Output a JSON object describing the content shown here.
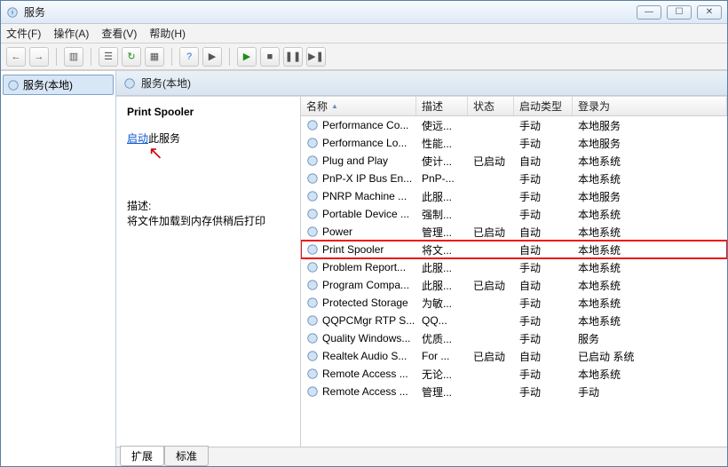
{
  "window": {
    "title": "服务"
  },
  "menu": {
    "file": "文件(F)",
    "action": "操作(A)",
    "view": "查看(V)",
    "help": "帮助(H)"
  },
  "toolbar_icons": {
    "back": "←",
    "forward": "→",
    "up": "↑",
    "show_hide": "▥",
    "props": "☰",
    "refresh": "↻",
    "export": "▦",
    "help": "?",
    "run": "▶",
    "play": "▶",
    "stop": "■",
    "pause": "❚❚",
    "restart": "▶❚"
  },
  "left": {
    "root": "服务(本地)"
  },
  "right_header": {
    "label": "服务(本地)"
  },
  "detail": {
    "title": "Print Spooler",
    "start_link": "启动",
    "start_suffix": "此服务",
    "desc_label": "描述:",
    "desc_text": "将文件加载到内存供稍后打印"
  },
  "columns": {
    "name": "名称",
    "desc": "描述",
    "status": "状态",
    "startup": "启动类型",
    "logon": "登录为"
  },
  "tabs": {
    "extended": "扩展",
    "standard": "标准"
  },
  "rows": [
    {
      "name": "Performance Co...",
      "desc": "使远...",
      "status": "",
      "startup": "手动",
      "logon": "本地服务"
    },
    {
      "name": "Performance Lo...",
      "desc": "性能...",
      "status": "",
      "startup": "手动",
      "logon": "本地服务"
    },
    {
      "name": "Plug and Play",
      "desc": "使计...",
      "status": "已启动",
      "startup": "自动",
      "logon": "本地系统"
    },
    {
      "name": "PnP-X IP Bus En...",
      "desc": "PnP-...",
      "status": "",
      "startup": "手动",
      "logon": "本地系统"
    },
    {
      "name": "PNRP Machine ...",
      "desc": "此服...",
      "status": "",
      "startup": "手动",
      "logon": "本地服务"
    },
    {
      "name": "Portable Device ...",
      "desc": "强制...",
      "status": "",
      "startup": "手动",
      "logon": "本地系统"
    },
    {
      "name": "Power",
      "desc": "管理...",
      "status": "已启动",
      "startup": "自动",
      "logon": "本地系统"
    },
    {
      "name": "Print Spooler",
      "desc": "将文...",
      "status": "",
      "startup": "自动",
      "logon": "本地系统",
      "selected": true
    },
    {
      "name": "Problem Report...",
      "desc": "此服...",
      "status": "",
      "startup": "手动",
      "logon": "本地系统"
    },
    {
      "name": "Program Compa...",
      "desc": "此服...",
      "status": "已启动",
      "startup": "自动",
      "logon": "本地系统"
    },
    {
      "name": "Protected Storage",
      "desc": "为敏...",
      "status": "",
      "startup": "手动",
      "logon": "本地系统"
    },
    {
      "name": "QQPCMgr RTP S...",
      "desc": "QQ...",
      "status": "",
      "startup": "手动",
      "logon": "本地系统"
    },
    {
      "name": "Quality Windows...",
      "desc": "优质...",
      "status": "",
      "startup": "手动",
      "logon": "服务"
    },
    {
      "name": "Realtek Audio S...",
      "desc": "For ...",
      "status": "已启动",
      "startup": "自动",
      "logon": "已启动   系统"
    },
    {
      "name": "Remote Access ...",
      "desc": "无论...",
      "status": "",
      "startup": "手动",
      "logon": "本地系统"
    },
    {
      "name": "Remote Access ...",
      "desc": "管理...",
      "status": "",
      "startup": "手动",
      "logon": "手动"
    }
  ]
}
